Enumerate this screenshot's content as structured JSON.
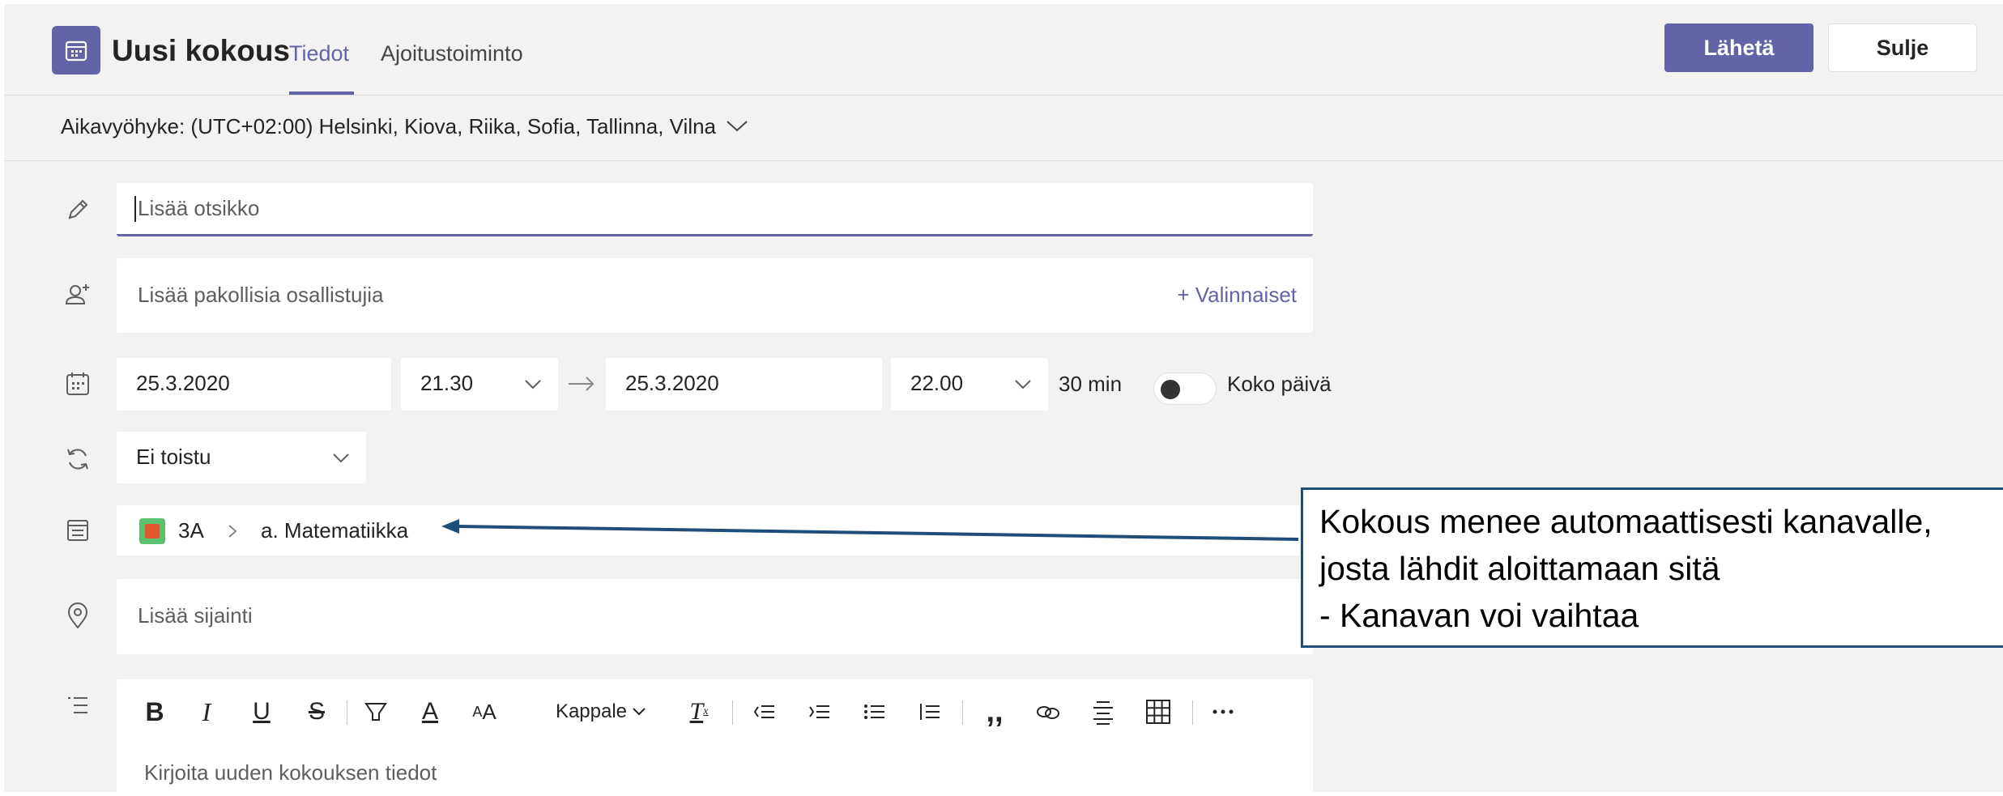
{
  "header": {
    "title": "Uusi kokous",
    "tabs": [
      {
        "label": "Tiedot",
        "active": true
      },
      {
        "label": "Ajoitustoiminto",
        "active": false
      }
    ],
    "send_label": "Lähetä",
    "close_label": "Sulje"
  },
  "timezone": {
    "label": "Aikavyöhyke: (UTC+02:00) Helsinki, Kiova, Riika, Sofia, Tallinna, Vilna"
  },
  "form": {
    "title_placeholder": "Lisää otsikko",
    "attendees_placeholder": "Lisää pakollisia osallistujia",
    "optional_label": "+ Valinnaiset",
    "start_date": "25.3.2020",
    "start_time": "21.30",
    "end_date": "25.3.2020",
    "end_time": "22.00",
    "duration": "30 min",
    "all_day_label": "Koko päivä",
    "all_day_on": false,
    "repeat": "Ei toistu",
    "channel_team": "3A",
    "channel_name": "a. Matematiikka",
    "location_placeholder": "Lisää sijainti"
  },
  "editor": {
    "paragraph_label": "Kappale",
    "placeholder": "Kirjoita uuden kokouksen tiedot",
    "toolbar_icons": [
      "bold-icon",
      "italic-icon",
      "underline-icon",
      "strikethrough-icon",
      "highlight-icon",
      "font-color-icon",
      "font-size-icon",
      "paragraph-dropdown",
      "clear-format-icon",
      "decrease-indent-icon",
      "increase-indent-icon",
      "bulleted-list-icon",
      "numbered-list-icon",
      "quote-icon",
      "link-icon",
      "align-icon",
      "table-icon",
      "more-icon"
    ]
  },
  "callout": {
    "lines": [
      "Kokous menee automaattisesti kanavalle,",
      "josta lähdit aloittamaan sitä",
      "- Kanavan voi vaihtaa"
    ]
  },
  "colors": {
    "accent": "#6264a7",
    "background": "#f3f2f1",
    "callout_border": "#1f4e79"
  }
}
